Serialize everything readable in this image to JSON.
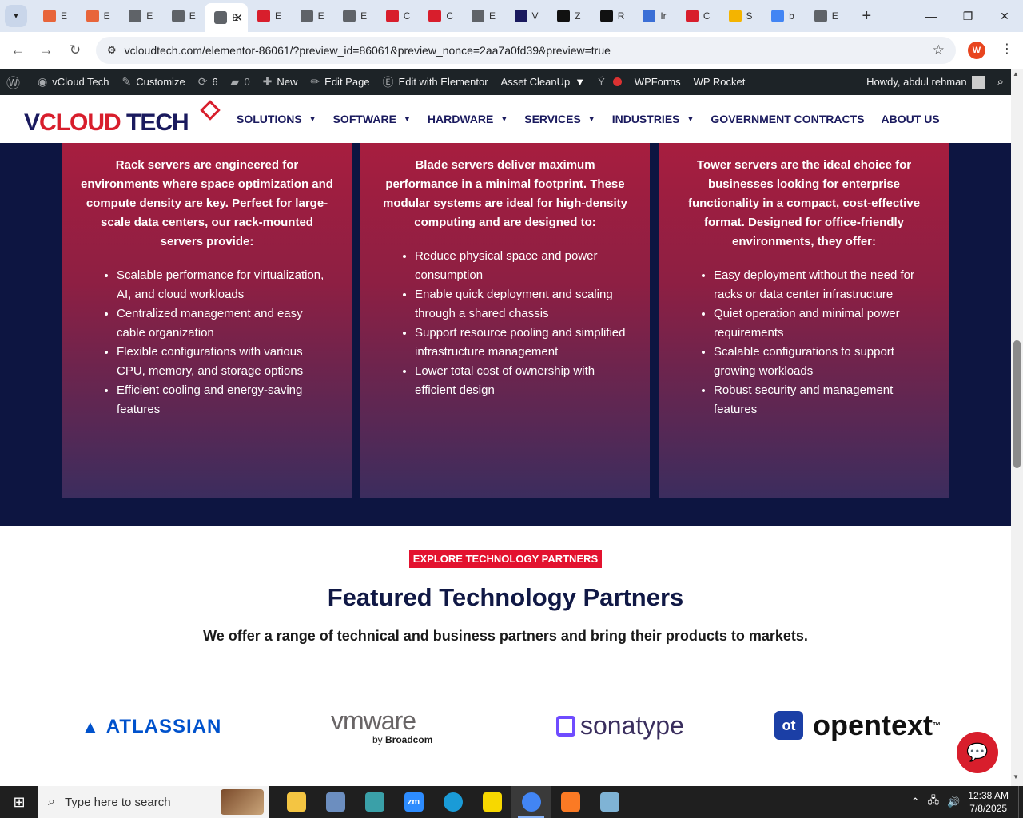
{
  "browser": {
    "tabs": [
      {
        "letter": "E",
        "color": "#e8653a",
        "active": false
      },
      {
        "letter": "E",
        "color": "#e8653a",
        "active": false
      },
      {
        "letter": "E",
        "color": "#5f6368",
        "active": false
      },
      {
        "letter": "E",
        "color": "#5f6368",
        "active": false
      },
      {
        "letter": "E",
        "color": "#5f6368",
        "active": true
      },
      {
        "letter": "E",
        "color": "#d81e2c",
        "active": false
      },
      {
        "letter": "E",
        "color": "#5f6368",
        "active": false
      },
      {
        "letter": "E",
        "color": "#5f6368",
        "active": false
      },
      {
        "letter": "C",
        "color": "#d81e2c",
        "active": false
      },
      {
        "letter": "C",
        "color": "#d81e2c",
        "active": false
      },
      {
        "letter": "E",
        "color": "#5f6368",
        "active": false
      },
      {
        "letter": "V",
        "color": "#1a1a5e",
        "active": false
      },
      {
        "letter": "Z",
        "color": "#111111",
        "active": false
      },
      {
        "letter": "R",
        "color": "#111111",
        "active": false
      },
      {
        "letter": "Ir",
        "color": "#3b6fd6",
        "active": false
      },
      {
        "letter": "C",
        "color": "#d81e2c",
        "active": false
      },
      {
        "letter": "S",
        "color": "#f4b400",
        "active": false
      },
      {
        "letter": "b",
        "color": "#4285f4",
        "active": false
      },
      {
        "letter": "E",
        "color": "#5f6368",
        "active": false
      }
    ],
    "url": "vcloudtech.com/elementor-86061/?preview_id=86061&preview_nonce=2aa7a0fd39&preview=true",
    "profile_initial": "W"
  },
  "adminbar": {
    "site_name": "vCloud Tech",
    "customize": "Customize",
    "updates_count": "6",
    "comments_count": "0",
    "new": "New",
    "edit_page": "Edit Page",
    "edit_elementor": "Edit with Elementor",
    "asset_cleanup": "Asset CleanUp",
    "wpforms": "WPForms",
    "wprocket": "WP Rocket",
    "howdy": "Howdy, abdul rehman"
  },
  "site": {
    "logo_part1": "V",
    "logo_part2": "CLOUD",
    "logo_part3": " TECH",
    "nav": [
      {
        "label": "SOLUTIONS",
        "dropdown": true
      },
      {
        "label": "SOFTWARE",
        "dropdown": true
      },
      {
        "label": "HARDWARE",
        "dropdown": true
      },
      {
        "label": "SERVICES",
        "dropdown": true
      },
      {
        "label": "INDUSTRIES",
        "dropdown": true
      },
      {
        "label": "GOVERNMENT CONTRACTS",
        "dropdown": false
      },
      {
        "label": "ABOUT US",
        "dropdown": false
      }
    ]
  },
  "cards": [
    {
      "intro": "Rack servers are engineered for environments where space optimization and compute density are key. Perfect for large-scale data centers, our rack-mounted servers provide:",
      "bullets": [
        "Scalable performance for virtualization, AI, and cloud workloads",
        "Centralized management and easy cable organization",
        "Flexible configurations with various CPU, memory, and storage options",
        "Efficient cooling and energy-saving features"
      ]
    },
    {
      "intro": "Blade servers deliver maximum performance in a minimal footprint. These modular systems are ideal for high-density computing and are designed to:",
      "bullets": [
        "Reduce physical space and power consumption",
        "Enable quick deployment and scaling through a shared chassis",
        "Support resource pooling and simplified infrastructure management",
        "Lower total cost of ownership with efficient design"
      ]
    },
    {
      "intro": "Tower servers are the ideal choice for businesses looking for enterprise functionality in a compact, cost-effective format. Designed for office-friendly environments, they offer:",
      "bullets": [
        "Easy deployment without the need for racks or data center infrastructure",
        "Quiet operation and minimal power requirements",
        "Scalable configurations to support growing workloads",
        "Robust security and management features"
      ]
    }
  ],
  "partners": {
    "badge": "EXPLORE TECHNOLOGY PARTNERS",
    "title": "Featured Technology Partners",
    "subtitle": "We offer a range of technical and business partners and bring their products to markets.",
    "logos": {
      "atlassian": "ATLASSIAN",
      "vmware": "vmware",
      "vmware_by": "by ",
      "vmware_broadcom": "Broadcom",
      "sonatype": "sonatype",
      "opentext": "opentext",
      "opentext_tm": "™"
    }
  },
  "taskbar": {
    "search_placeholder": "Type here to search",
    "time": "12:38 AM",
    "date": "7/8/2025",
    "apps": [
      {
        "name": "file-explorer",
        "color": "#f4c542",
        "label": ""
      },
      {
        "name": "app-2",
        "color": "#6c8ebf",
        "label": ""
      },
      {
        "name": "app-3",
        "color": "#3aa0a8",
        "label": ""
      },
      {
        "name": "zoom",
        "color": "#2d8cff",
        "label": "zm"
      },
      {
        "name": "edge",
        "color": "#1a9bd7",
        "label": ""
      },
      {
        "name": "sticky-notes",
        "color": "#f7d800",
        "label": ""
      },
      {
        "name": "chrome",
        "color": "#4285f4",
        "label": ""
      },
      {
        "name": "xampp",
        "color": "#fb7a24",
        "label": ""
      },
      {
        "name": "app-9",
        "color": "#7fb3d5",
        "label": ""
      }
    ]
  }
}
